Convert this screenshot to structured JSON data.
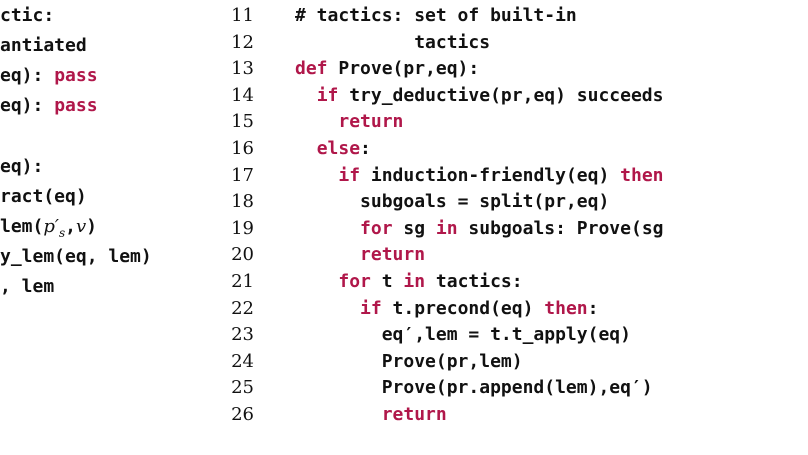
{
  "colors": {
    "text": "#111111",
    "keyword": "#b0174a",
    "background": "#ffffff"
  },
  "left_column": {
    "lines": [
      {
        "pre": "ctic:",
        "kw": "",
        "post": ""
      },
      {
        "pre": "antiated",
        "kw": "",
        "post": ""
      },
      {
        "pre": "eq): ",
        "kw": "pass",
        "post": ""
      },
      {
        "pre": "eq): ",
        "kw": "pass",
        "post": ""
      },
      {
        "pre": "",
        "kw": "",
        "post": ""
      },
      {
        "pre": "eq):",
        "kw": "",
        "post": ""
      },
      {
        "pre": "ract(eq)",
        "kw": "",
        "post": ""
      },
      {
        "pre": "lem(",
        "math_var": "p",
        "math_prime": "′",
        "math_sub": "s",
        "post": ",",
        "math_v": "v",
        "close": ")"
      },
      {
        "pre": "y_lem(eq, lem)",
        "kw": "",
        "post": ""
      },
      {
        "pre": ", lem",
        "kw": "",
        "post": ""
      }
    ]
  },
  "right_column": {
    "line_numbers": [
      "11",
      "12",
      "13",
      "14",
      "15",
      "16",
      "17",
      "18",
      "19",
      "20",
      "21",
      "22",
      "23",
      "24",
      "25",
      "26"
    ],
    "lines": [
      {
        "indent": "",
        "segments": [
          [
            "t",
            "# tactics: set of built-in"
          ]
        ]
      },
      {
        "indent": "",
        "segments": [
          [
            "t",
            "           tactics"
          ]
        ]
      },
      {
        "indent": "",
        "segments": [
          [
            "k",
            "def"
          ],
          [
            "t",
            " Prove(pr,eq):"
          ]
        ]
      },
      {
        "indent": "  ",
        "segments": [
          [
            "k",
            "if"
          ],
          [
            "t",
            " try_deductive(pr,eq) succeeds"
          ]
        ]
      },
      {
        "indent": "    ",
        "segments": [
          [
            "k",
            "return"
          ]
        ]
      },
      {
        "indent": "  ",
        "segments": [
          [
            "k",
            "else"
          ],
          [
            "t",
            ":"
          ]
        ]
      },
      {
        "indent": "    ",
        "segments": [
          [
            "k",
            "if"
          ],
          [
            "t",
            " induction-friendly(eq) "
          ],
          [
            "k",
            "then"
          ]
        ]
      },
      {
        "indent": "      ",
        "segments": [
          [
            "t",
            "subgoals = split(pr,eq)"
          ]
        ]
      },
      {
        "indent": "      ",
        "segments": [
          [
            "k",
            "for"
          ],
          [
            "t",
            " sg "
          ],
          [
            "k",
            "in"
          ],
          [
            "t",
            " subgoals: Prove(sg"
          ]
        ]
      },
      {
        "indent": "      ",
        "segments": [
          [
            "k",
            "return"
          ]
        ]
      },
      {
        "indent": "    ",
        "segments": [
          [
            "k",
            "for"
          ],
          [
            "t",
            " t "
          ],
          [
            "k",
            "in"
          ],
          [
            "t",
            " tactics:"
          ]
        ]
      },
      {
        "indent": "      ",
        "segments": [
          [
            "k",
            "if"
          ],
          [
            "t",
            " t.precond(eq) "
          ],
          [
            "k",
            "then"
          ],
          [
            "t",
            ":"
          ]
        ]
      },
      {
        "indent": "        ",
        "segments": [
          [
            "t",
            "eq′,lem = t.t_apply(eq)"
          ]
        ]
      },
      {
        "indent": "        ",
        "segments": [
          [
            "t",
            "Prove(pr,lem)"
          ]
        ]
      },
      {
        "indent": "        ",
        "segments": [
          [
            "t",
            "Prove(pr.append(lem),eq′)"
          ]
        ]
      },
      {
        "indent": "        ",
        "segments": [
          [
            "k",
            "return"
          ]
        ]
      }
    ]
  }
}
